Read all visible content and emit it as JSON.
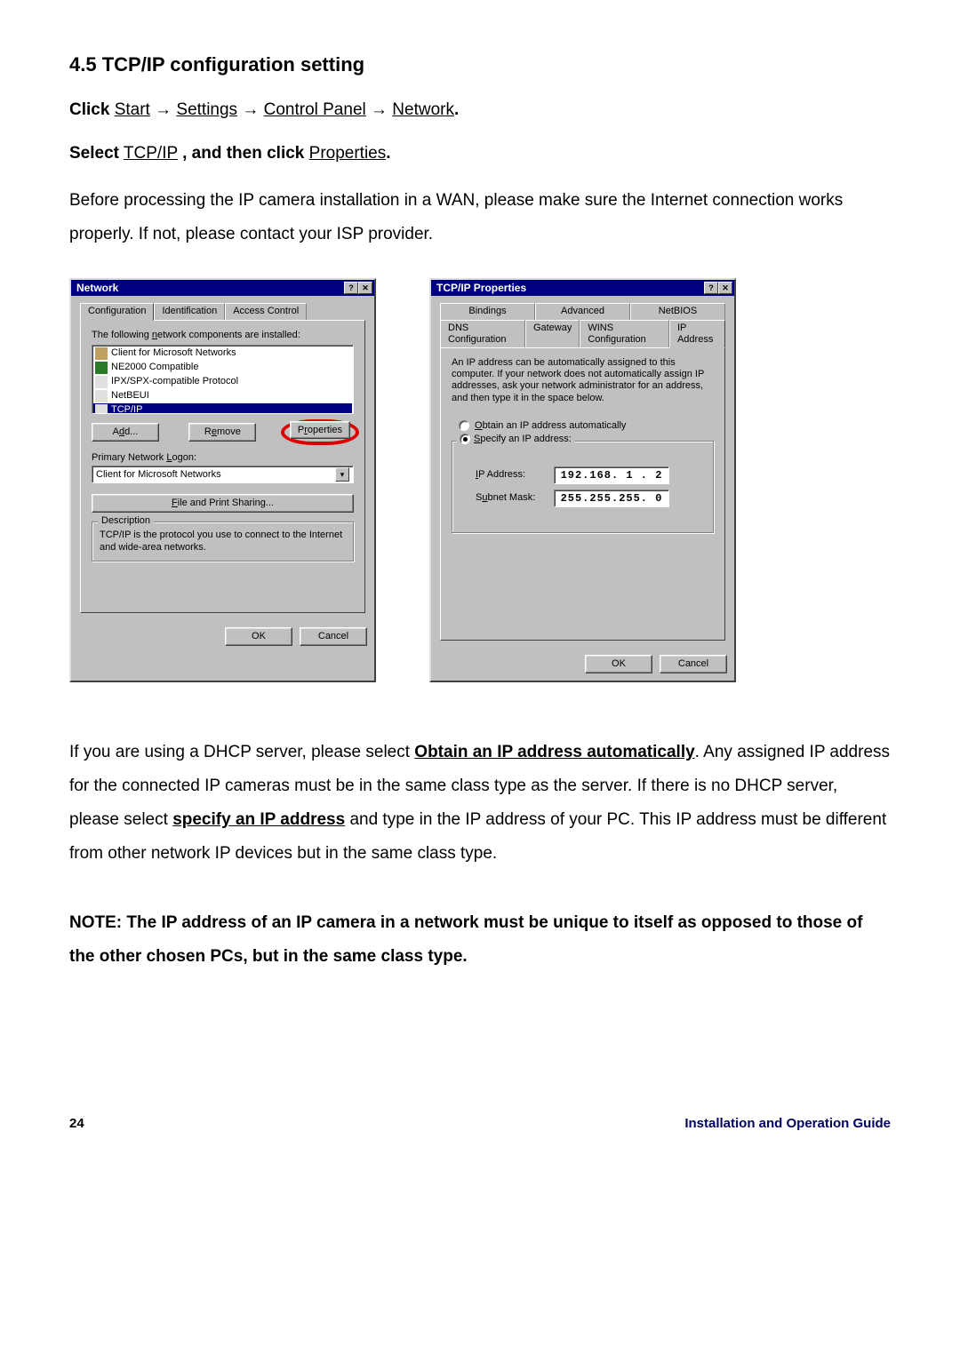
{
  "doc": {
    "section_heading": "4.5 TCP/IP configuration setting",
    "line_click_label": "Click",
    "nav_start": "Start",
    "nav_settings": "Settings",
    "nav_control_panel": "Control Panel",
    "nav_network": "Network",
    "arrow": "→",
    "line_select_label": "Select",
    "select_tcpip": "TCP/IP",
    "and_then_click": ", and then click",
    "properties_word": "Properties",
    "para1": "Before processing the IP camera installation in a WAN, please make sure the Internet connection works properly. If not, please contact your ISP provider.",
    "para2_a": "If you are using a DHCP server, please select ",
    "para2_bold": "Obtain an IP address automatically",
    "para2_b": ". Any assigned IP address for the connected IP cameras must be in the same class type as the server. If there is no DHCP server, please select ",
    "para2_bold2": "specify an IP address",
    "para2_c": " and type in the IP address of your PC. This IP address must be different from other network IP devices but in the same class type.",
    "note": "NOTE: The IP address of an IP camera in a network must be unique to itself as opposed to those of the other chosen PCs, but in the same class type.",
    "page_number": "24",
    "footer_guide": "Installation and Operation Guide"
  },
  "network_dialog": {
    "title": "Network",
    "help_glyph": "?",
    "close_glyph": "✕",
    "tabs": {
      "configuration": "Configuration",
      "identification": "Identification",
      "access_control": "Access Control"
    },
    "list_label_a": "The following ",
    "list_label_mn": "n",
    "list_label_b": "etwork components are installed:",
    "components": {
      "c0": "Client for Microsoft Networks",
      "c1": "NE2000 Compatible",
      "c2": "IPX/SPX-compatible Protocol",
      "c3": "NetBEUI",
      "c4": "TCP/IP"
    },
    "btn_add_a": "A",
    "btn_add_mn": "d",
    "btn_add_b": "d...",
    "btn_remove_a": "R",
    "btn_remove_mn": "e",
    "btn_remove_b": "move",
    "btn_props_a": "P",
    "btn_props_mn": "r",
    "btn_props_b": "operties",
    "primary_logon_a": "Primary Network ",
    "primary_logon_mn": "L",
    "primary_logon_b": "ogon:",
    "primary_logon_value": "Client for Microsoft Networks",
    "btn_fps_a": "",
    "btn_fps_mn": "F",
    "btn_fps_b": "ile and Print Sharing...",
    "desc_legend": "Description",
    "desc_text": "TCP/IP is the protocol you use to connect to the Internet and wide-area networks.",
    "ok": "OK",
    "cancel": "Cancel"
  },
  "tcp_dialog": {
    "title": "TCP/IP Properties",
    "help_glyph": "?",
    "close_glyph": "✕",
    "tabs_row1": {
      "bindings": "Bindings",
      "advanced": "Advanced",
      "netbios": "NetBIOS"
    },
    "tabs_row2": {
      "dns": "DNS Configuration",
      "gateway": "Gateway",
      "wins": "WINS Configuration",
      "ip": "IP Address"
    },
    "intro": "An IP address can be automatically assigned to this computer. If your network does not automatically assign IP addresses, ask your network administrator for an address, and then type it in the space below.",
    "radio_obtain_a": "",
    "radio_obtain_mn": "O",
    "radio_obtain_b": "btain an IP address automatically",
    "radio_specify_a": "",
    "radio_specify_mn": "S",
    "radio_specify_b": "pecify an IP address:",
    "ip_label_a": "",
    "ip_label_mn": "I",
    "ip_label_b": "P Address:",
    "ip_value": "192.168. 1 . 2",
    "subnet_label_a": "S",
    "subnet_label_mn": "u",
    "subnet_label_b": "bnet Mask:",
    "subnet_value": "255.255.255. 0",
    "ok": "OK",
    "cancel": "Cancel"
  }
}
